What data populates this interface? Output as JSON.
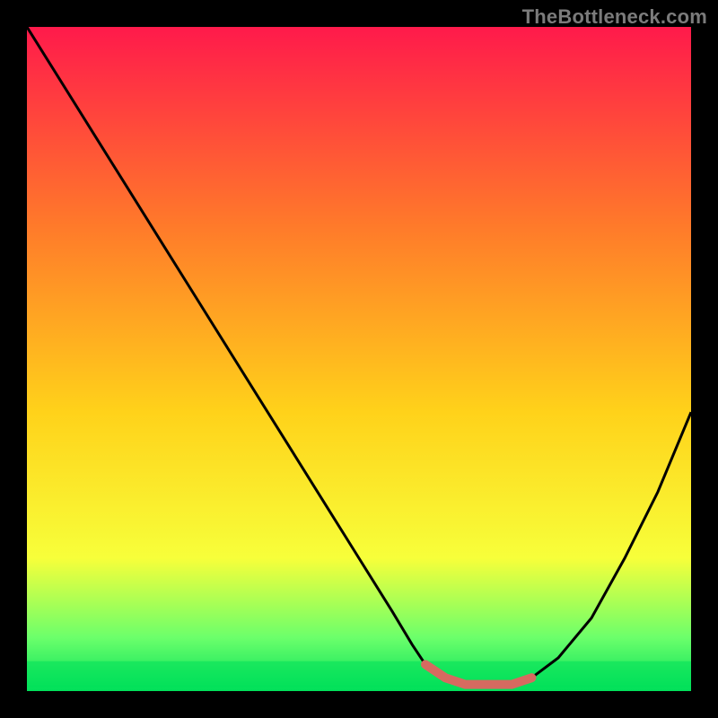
{
  "watermark": "TheBottleneck.com",
  "chart_data": {
    "type": "line",
    "title": "",
    "xlabel": "",
    "ylabel": "",
    "xlim": [
      0,
      100
    ],
    "ylim": [
      0,
      100
    ],
    "grid": false,
    "legend": false,
    "colors": {
      "gradient_top": "#ff1a4b",
      "gradient_mid_upper": "#ff7a2a",
      "gradient_mid": "#ffd21a",
      "gradient_lower": "#f7ff3a",
      "gradient_band": "#6bff6b",
      "gradient_bottom": "#00e05a",
      "curve": "#000000",
      "highlight_segment": "#d66a60"
    },
    "series": [
      {
        "name": "bottleneck-curve",
        "x": [
          0,
          5,
          10,
          15,
          20,
          25,
          30,
          35,
          40,
          45,
          50,
          55,
          58,
          60,
          63,
          66,
          70,
          73,
          76,
          80,
          85,
          90,
          95,
          100
        ],
        "y": [
          100,
          92,
          84,
          76,
          68,
          60,
          52,
          44,
          36,
          28,
          20,
          12,
          7,
          4,
          2,
          1,
          1,
          1,
          2,
          5,
          11,
          20,
          30,
          42
        ]
      }
    ],
    "highlight": {
      "name": "flat-minimum",
      "x": [
        60,
        63,
        66,
        70,
        73,
        76
      ],
      "y": [
        4,
        2,
        1,
        1,
        1,
        2
      ]
    },
    "annotations": []
  }
}
